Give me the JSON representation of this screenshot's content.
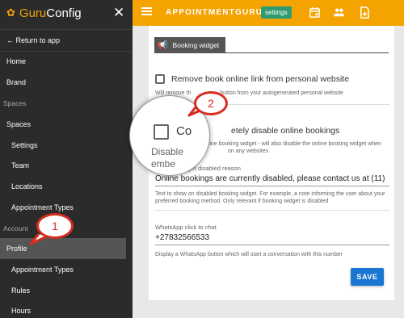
{
  "brand": {
    "guru": "Guru",
    "config": "Config",
    "icon": "gear-icon"
  },
  "sidebar": {
    "return_label": "← Return to app",
    "items": [
      {
        "label": "Home",
        "kind": "top"
      },
      {
        "label": "Brand",
        "kind": "top"
      },
      {
        "label": "Spaces",
        "kind": "section"
      },
      {
        "label": "Spaces",
        "kind": "top"
      },
      {
        "label": "Settings",
        "kind": "sub"
      },
      {
        "label": "Team",
        "kind": "sub"
      },
      {
        "label": "Locations",
        "kind": "sub"
      },
      {
        "label": "Appointment Types",
        "kind": "sub"
      },
      {
        "label": "Account",
        "kind": "section"
      },
      {
        "label": "Profile",
        "kind": "top",
        "active": true
      },
      {
        "label": "Appointment Types",
        "kind": "sub"
      },
      {
        "label": "Rules",
        "kind": "sub"
      },
      {
        "label": "Hours",
        "kind": "sub"
      }
    ]
  },
  "topbar": {
    "title": "APPOINTMENTGURU.",
    "settings_chip": "settings",
    "icons": [
      "calendar-icon",
      "people-icon",
      "add-note-icon"
    ]
  },
  "widget": {
    "section_title": "Booking widget",
    "remove_link_label": "Remove book online link from personal website",
    "remove_link_help_a": "Will remove th",
    "remove_link_help_b": "button from your autogenerated personal website",
    "disable_label_tail": "etely disable online bookings",
    "disable_help_a": "nline booking widget - will also disable the online booking widget when",
    "disable_help_b": "on any websites",
    "reason_label": "Booking widget disabled reason",
    "reason_value": "Online bookings are currently disabled, please contact us at (11)",
    "reason_help": "Text to show on disabled booking widget. For example, a note informing the user about your preferred booking method. Only relevant if booking widget is disabled",
    "whatsapp_label": "WhatsApp click to chat",
    "whatsapp_value": "+27832566533",
    "whatsapp_help": "Display a WhatsApp button which will start a conversation with this number",
    "save_label": "SAVE"
  },
  "magnifier": {
    "text1": "Co",
    "text2": "Disable",
    "text3": "embe"
  },
  "callouts": {
    "one": "1",
    "two": "2"
  }
}
